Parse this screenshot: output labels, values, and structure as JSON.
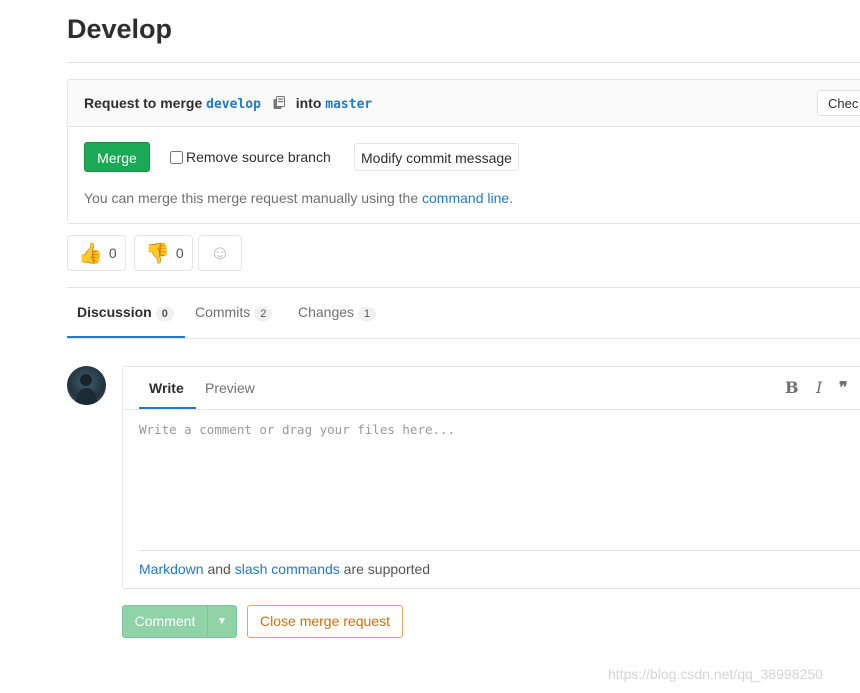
{
  "page": {
    "title": "Develop"
  },
  "merge": {
    "request_prefix": "Request to merge",
    "source_branch": "develop",
    "into": "into",
    "target_branch": "master",
    "check_button": "Chec",
    "merge_button": "Merge",
    "remove_source_branch": "Remove source branch",
    "modify_commit": "Modify commit message",
    "manual_text": "You can merge this merge request manually using the",
    "command_line_link": "command line",
    "manual_end": "."
  },
  "awards": {
    "thumbs_up_count": "0",
    "thumbs_down_count": "0"
  },
  "tabs": [
    {
      "label": "Discussion",
      "count": "0"
    },
    {
      "label": "Commits",
      "count": "2"
    },
    {
      "label": "Changes",
      "count": "1"
    }
  ],
  "editor": {
    "write_tab": "Write",
    "preview_tab": "Preview",
    "placeholder": "Write a comment or drag your files here...",
    "markdown_link": "Markdown",
    "and": "and",
    "slash_link": "slash commands",
    "supported": "are supported"
  },
  "actions": {
    "comment": "Comment",
    "close": "Close merge request"
  },
  "watermark": "https://blog.csdn.net/qq_38998250",
  "colors": {
    "accent": "#1f78d1",
    "merge_green": "#1aaa55",
    "close_orange": "#d0700b"
  }
}
